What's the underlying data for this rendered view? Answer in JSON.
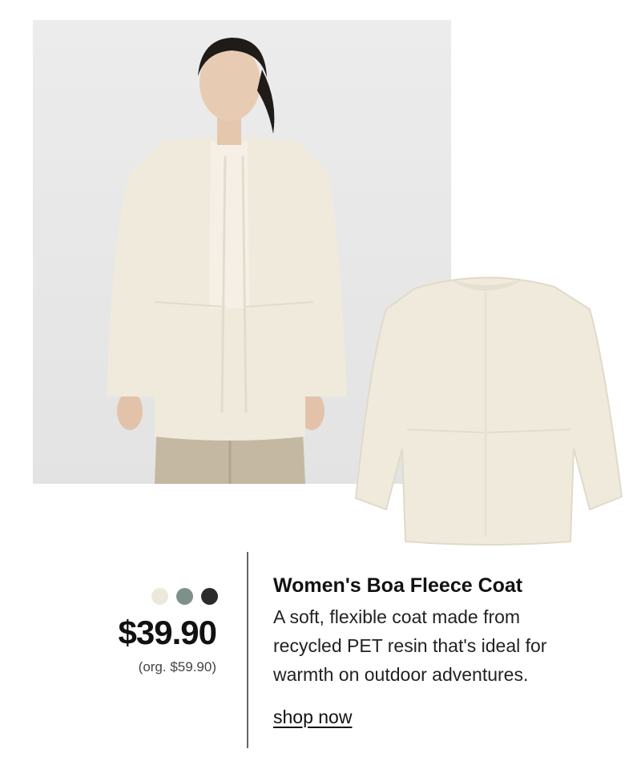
{
  "product": {
    "title": "Women's Boa Fleece Coat",
    "description": "A soft, flexible coat made from recycled PET resin that's ideal for warmth on outdoor adventures.",
    "price": "$39.90",
    "original_price": "(org. $59.90)",
    "shop_link": "shop now"
  },
  "swatches": [
    {
      "name": "ivory",
      "color": "#ede8da"
    },
    {
      "name": "sage green",
      "color": "#7d918a"
    },
    {
      "name": "black",
      "color": "#2b2b2b"
    }
  ],
  "colors": {
    "coat": "#efeadb",
    "photo_background": "#e7e7e7",
    "divider": "#666666"
  }
}
